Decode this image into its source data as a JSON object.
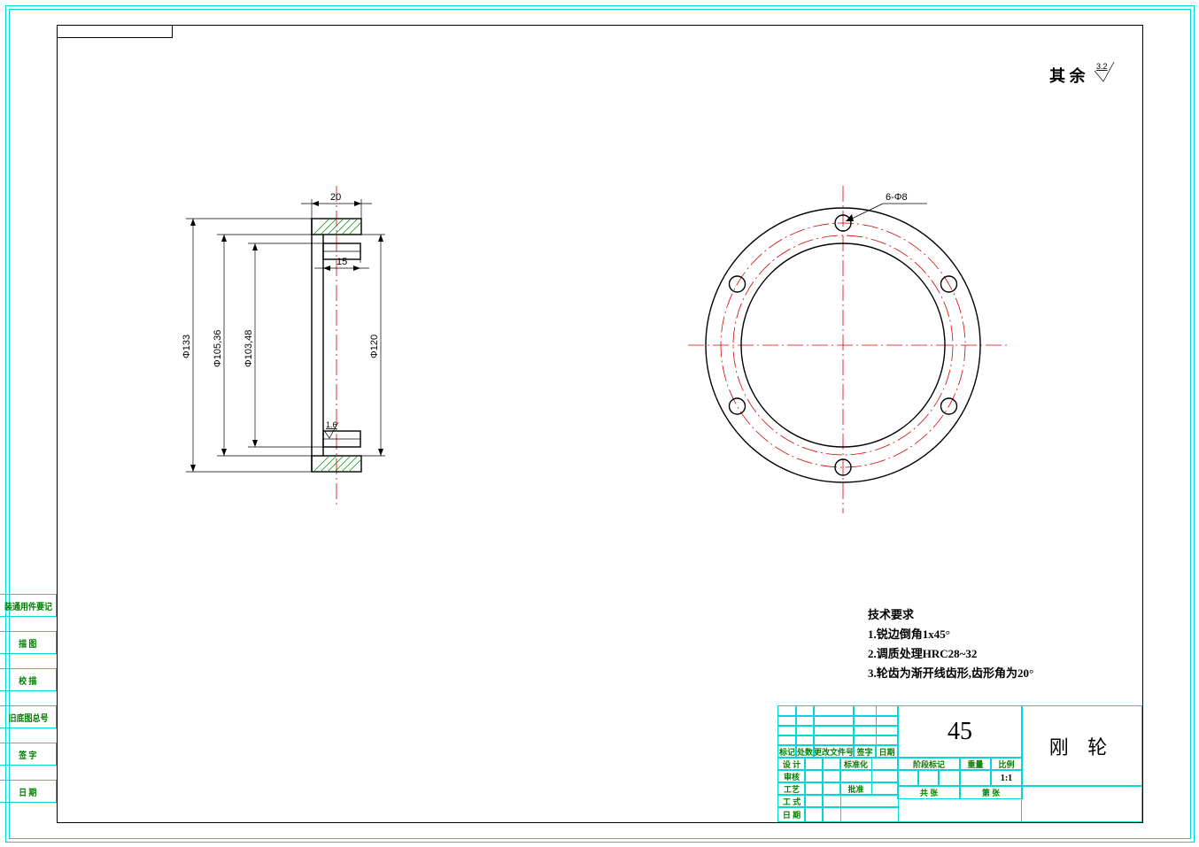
{
  "surface_note": {
    "prefix": "其 余",
    "value": "3.2"
  },
  "dims": {
    "d133": "Φ133",
    "d105_36": "Φ105,36",
    "d103_48": "Φ103,48",
    "d120": "Φ120",
    "w20": "20",
    "w15": "15",
    "ra16": "1.6",
    "holes": "6-Φ8"
  },
  "tech": {
    "title": "技术要求",
    "r1": "1.锐边倒角1x45°",
    "r2": "2.调质处理HRC28~32",
    "r3": "3.轮齿为渐开线齿形,齿形角为20°"
  },
  "left_labels": {
    "l1": "装通用件要记",
    "l2": "描 图",
    "l3": "校 描",
    "l4": "旧底图总号",
    "l5": "签 字",
    "l6": "日 期"
  },
  "titleblock": {
    "material": "45",
    "part_name": "刚  轮",
    "scale": "1:1",
    "h1": "标记",
    "h2": "处数",
    "h3": "更改文件号",
    "h4": "签字",
    "h5": "日期",
    "r1": "设 计",
    "r2": "标准化",
    "r3": "阶段标记",
    "r4": "重量",
    "r5": "比例",
    "r6": "审核",
    "r7": "工艺",
    "r8": "批准",
    "r9": "共  张",
    "r10": "第  张"
  }
}
